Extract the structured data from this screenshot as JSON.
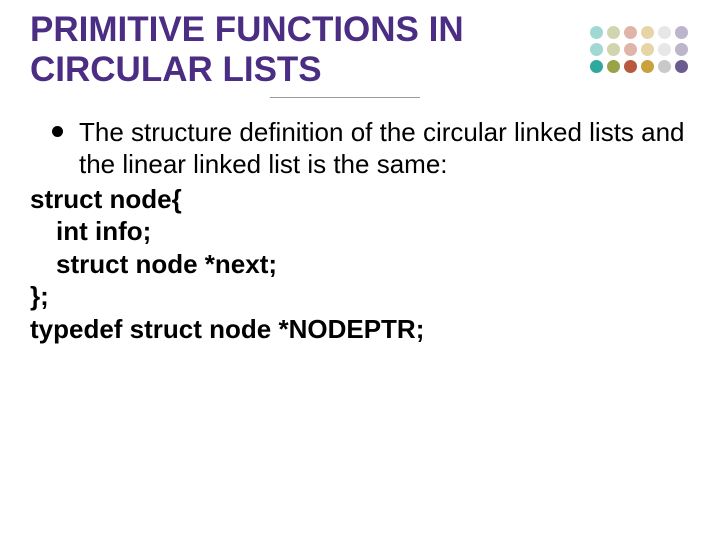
{
  "title": "PRIMITIVE FUNCTIONS IN CIRCULAR LISTS",
  "bullet": "The structure definition of the circular linked lists and the linear linked list is the same:",
  "code": {
    "l1": "struct node{",
    "l2": "int info;",
    "l3": "struct node *next;",
    "l4": "};",
    "l5": "typedef struct node *NODEPTR;"
  }
}
